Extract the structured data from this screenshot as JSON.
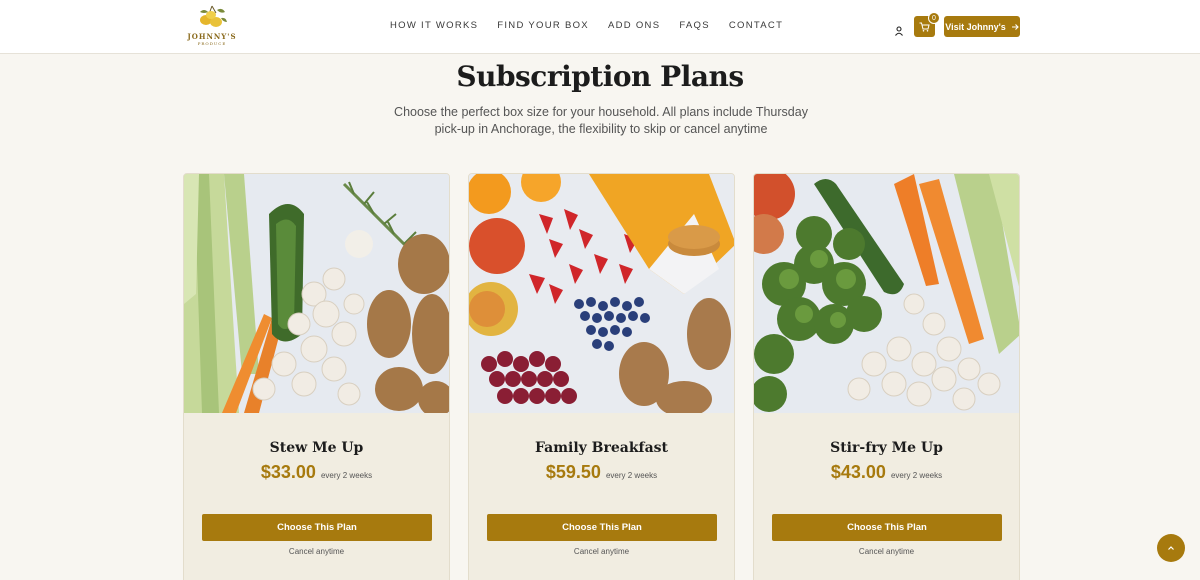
{
  "header": {
    "logo_text": "JOHNNY'S",
    "logo_sub": "PRODUCE",
    "nav": [
      "HOW IT WORKS",
      "FIND YOUR BOX",
      "ADD ONS",
      "FAQS",
      "CONTACT"
    ],
    "cart_count": "0",
    "visit_label": "Visit Johnny's"
  },
  "main": {
    "title": "Subscription Plans",
    "subtitle": "Choose the perfect box size for your household. All plans include Thursday pick-up in Anchorage, the flexibility to skip or cancel anytime"
  },
  "plans": [
    {
      "name": "Stew Me Up",
      "price": "$33.00",
      "frequency": "every 2 weeks",
      "button": "Choose This Plan",
      "note": "Cancel anytime"
    },
    {
      "name": "Family Breakfast",
      "price": "$59.50",
      "frequency": "every 2 weeks",
      "button": "Choose This Plan",
      "note": "Cancel anytime"
    },
    {
      "name": "Stir-fry Me Up",
      "price": "$43.00",
      "frequency": "every 2 weeks",
      "button": "Choose This Plan",
      "note": "Cancel anytime"
    }
  ],
  "images": {
    "plan_1": "vegetables-celery-carrots-zucchini-mushrooms-potatoes",
    "plan_2": "fruit-oranges-strawberries-apples-blueberries-grapes-pancake-mix-potatoes",
    "plan_3": "vegetables-broccoli-zucchini-carrots-celery-mushrooms"
  },
  "colors": {
    "accent": "#a77a0e",
    "card_bg": "#f1ede1",
    "page_bg": "#f8f6f1"
  },
  "icons": [
    "user-icon",
    "cart-icon",
    "arrow-right-icon",
    "chevron-up-icon"
  ]
}
